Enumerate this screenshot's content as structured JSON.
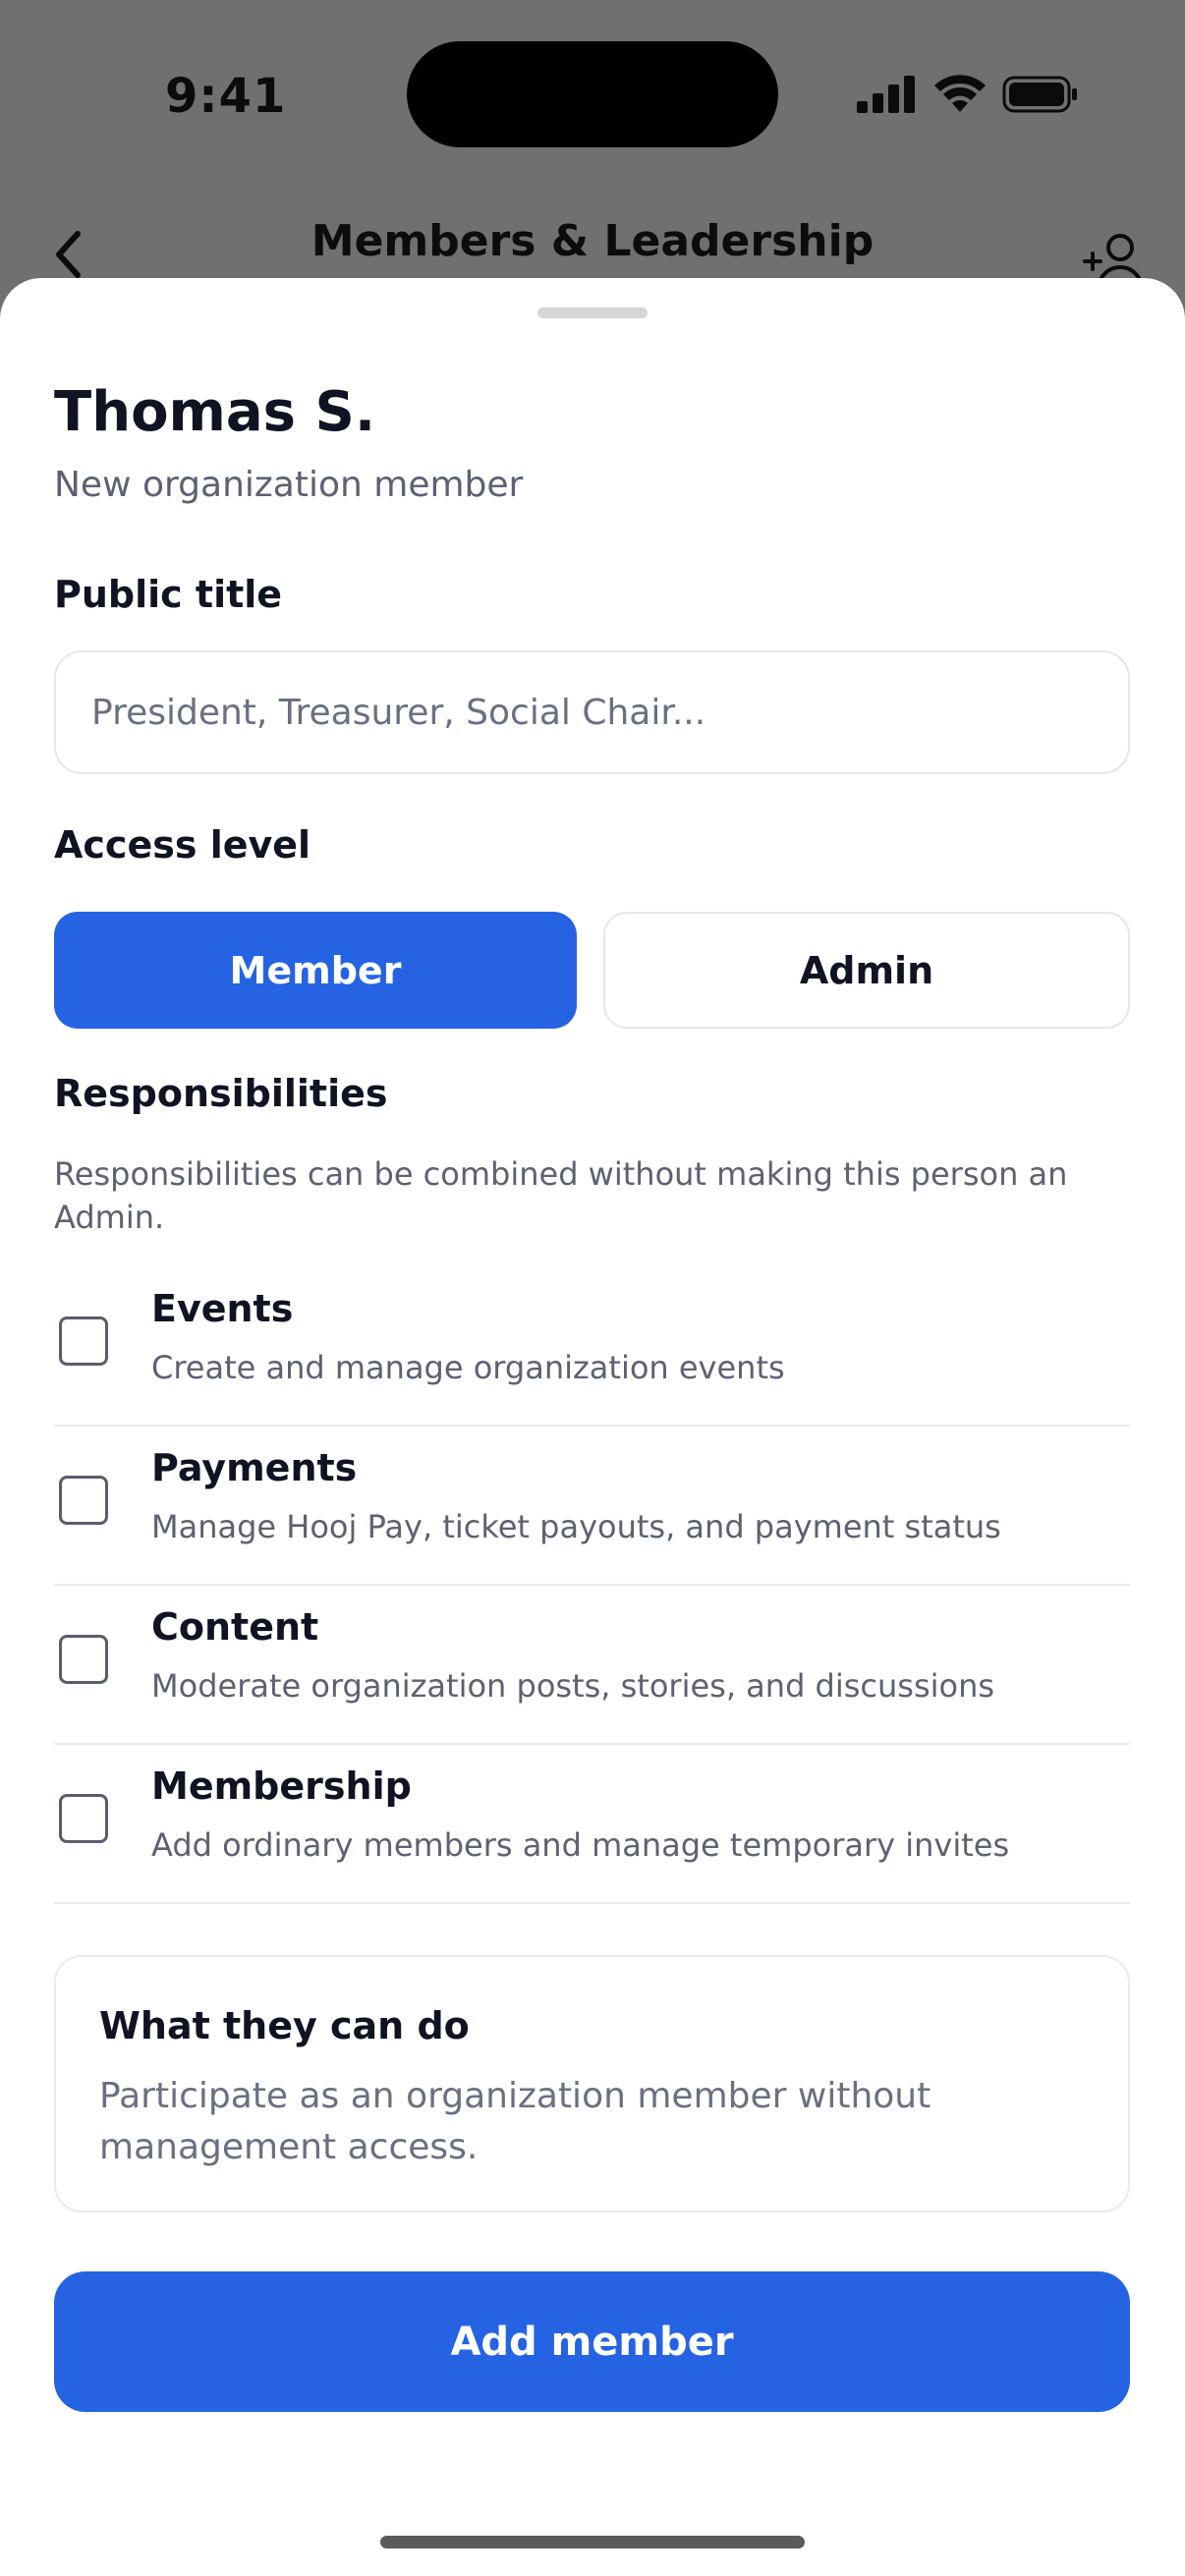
{
  "status_bar": {
    "time": "9:41",
    "icons": [
      "cellular-signal-icon",
      "wifi-icon",
      "battery-icon"
    ]
  },
  "nav": {
    "title": "Members & Leadership",
    "back_icon": "chevron-left-icon",
    "action_icon": "add-person-icon"
  },
  "sheet": {
    "name": "Thomas S.",
    "subtitle": "New organization member",
    "public_title": {
      "label": "Public title",
      "value": "",
      "placeholder": "President, Treasurer, Social Chair..."
    },
    "access_level": {
      "label": "Access level",
      "options": [
        "Member",
        "Admin"
      ],
      "selected": "Member"
    },
    "responsibilities": {
      "label": "Responsibilities",
      "help": "Responsibilities can be combined without making this person an Admin.",
      "items": [
        {
          "title": "Events",
          "description": "Create and manage organization events",
          "checked": false
        },
        {
          "title": "Payments",
          "description": "Manage Hooj Pay, ticket payouts, and payment status",
          "checked": false
        },
        {
          "title": "Content",
          "description": "Moderate organization posts, stories, and discussions",
          "checked": false
        },
        {
          "title": "Membership",
          "description": "Add ordinary members and manage temporary invites",
          "checked": false
        }
      ]
    },
    "info_card": {
      "title": "What they can do",
      "body": "Participate as an organization member without management access."
    },
    "submit_label": "Add member"
  },
  "colors": {
    "accent": "#2563e3",
    "backdrop": "#707070",
    "text_primary": "#0f1322",
    "text_secondary": "#5d6170"
  }
}
